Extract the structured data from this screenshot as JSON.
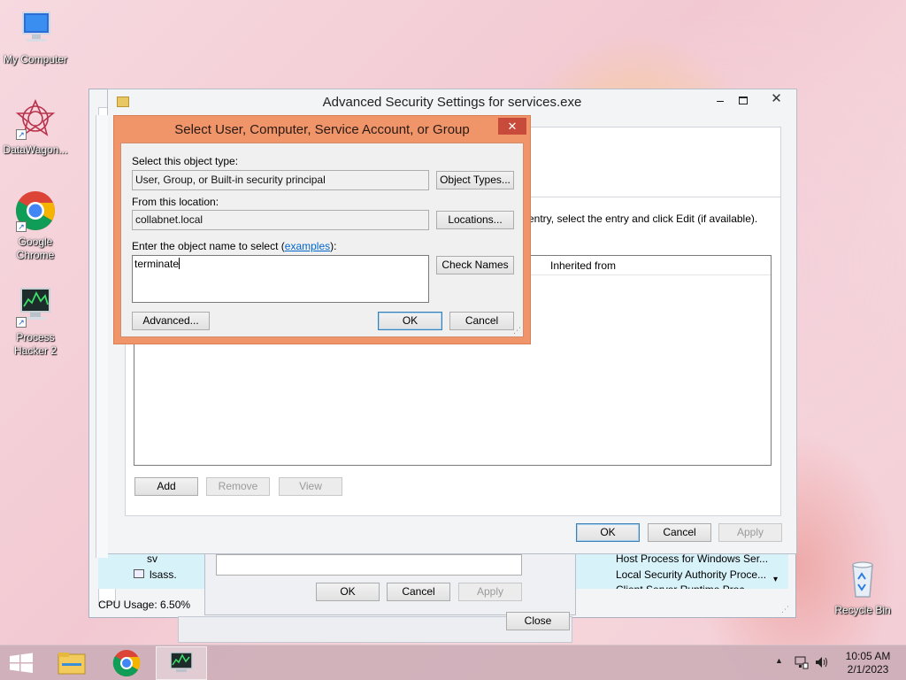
{
  "desktop": {
    "icons": [
      {
        "label": "My Computer"
      },
      {
        "label": "DataWagon..."
      },
      {
        "label": "Google Chrome"
      },
      {
        "label": "Process Hacker 2"
      },
      {
        "label": "Recycle Bin"
      }
    ]
  },
  "bg_window": {
    "cpu_usage": "CPU Usage: 6.50%",
    "rows": [
      {
        "name": "sv",
        "desc": "Host Process for Windows Ser..."
      },
      {
        "name": "lsass.",
        "desc": "Local Security Authority Proce..."
      },
      {
        "name": "",
        "desc": "Client Server Runtime Proc..."
      }
    ],
    "ok_label": "OK",
    "cancel_label": "Cancel",
    "apply_label": "Apply",
    "close_label": "Close"
  },
  "adv_security": {
    "title": "Advanced Security Settings for services.exe",
    "instruction": "entry, select the entry and click Edit (if available).",
    "column_inherited": "Inherited from",
    "add_label": "Add",
    "remove_label": "Remove",
    "view_label": "View",
    "ok_label": "OK",
    "cancel_label": "Cancel",
    "apply_label": "Apply"
  },
  "select_dialog": {
    "title": "Select User, Computer, Service Account, or Group",
    "object_type_label": "Select this object type:",
    "object_type_value": "User, Group, or Built-in security principal",
    "object_types_button": "Object Types...",
    "location_label": "From this location:",
    "location_value": "collabnet.local",
    "locations_button": "Locations...",
    "enter_label_prefix": "Enter the object name to select (",
    "examples_link": "examples",
    "enter_label_suffix": "):",
    "name_value": "terminate",
    "check_names_button": "Check Names",
    "advanced_button": "Advanced...",
    "ok_button": "OK",
    "cancel_button": "Cancel"
  },
  "taskbar": {
    "time": "10:05 AM",
    "date": "2/1/2023"
  },
  "colors": {
    "dialog_frame": "#f0956a",
    "window_frame": "#f3f4f6",
    "link": "#0066cc"
  }
}
